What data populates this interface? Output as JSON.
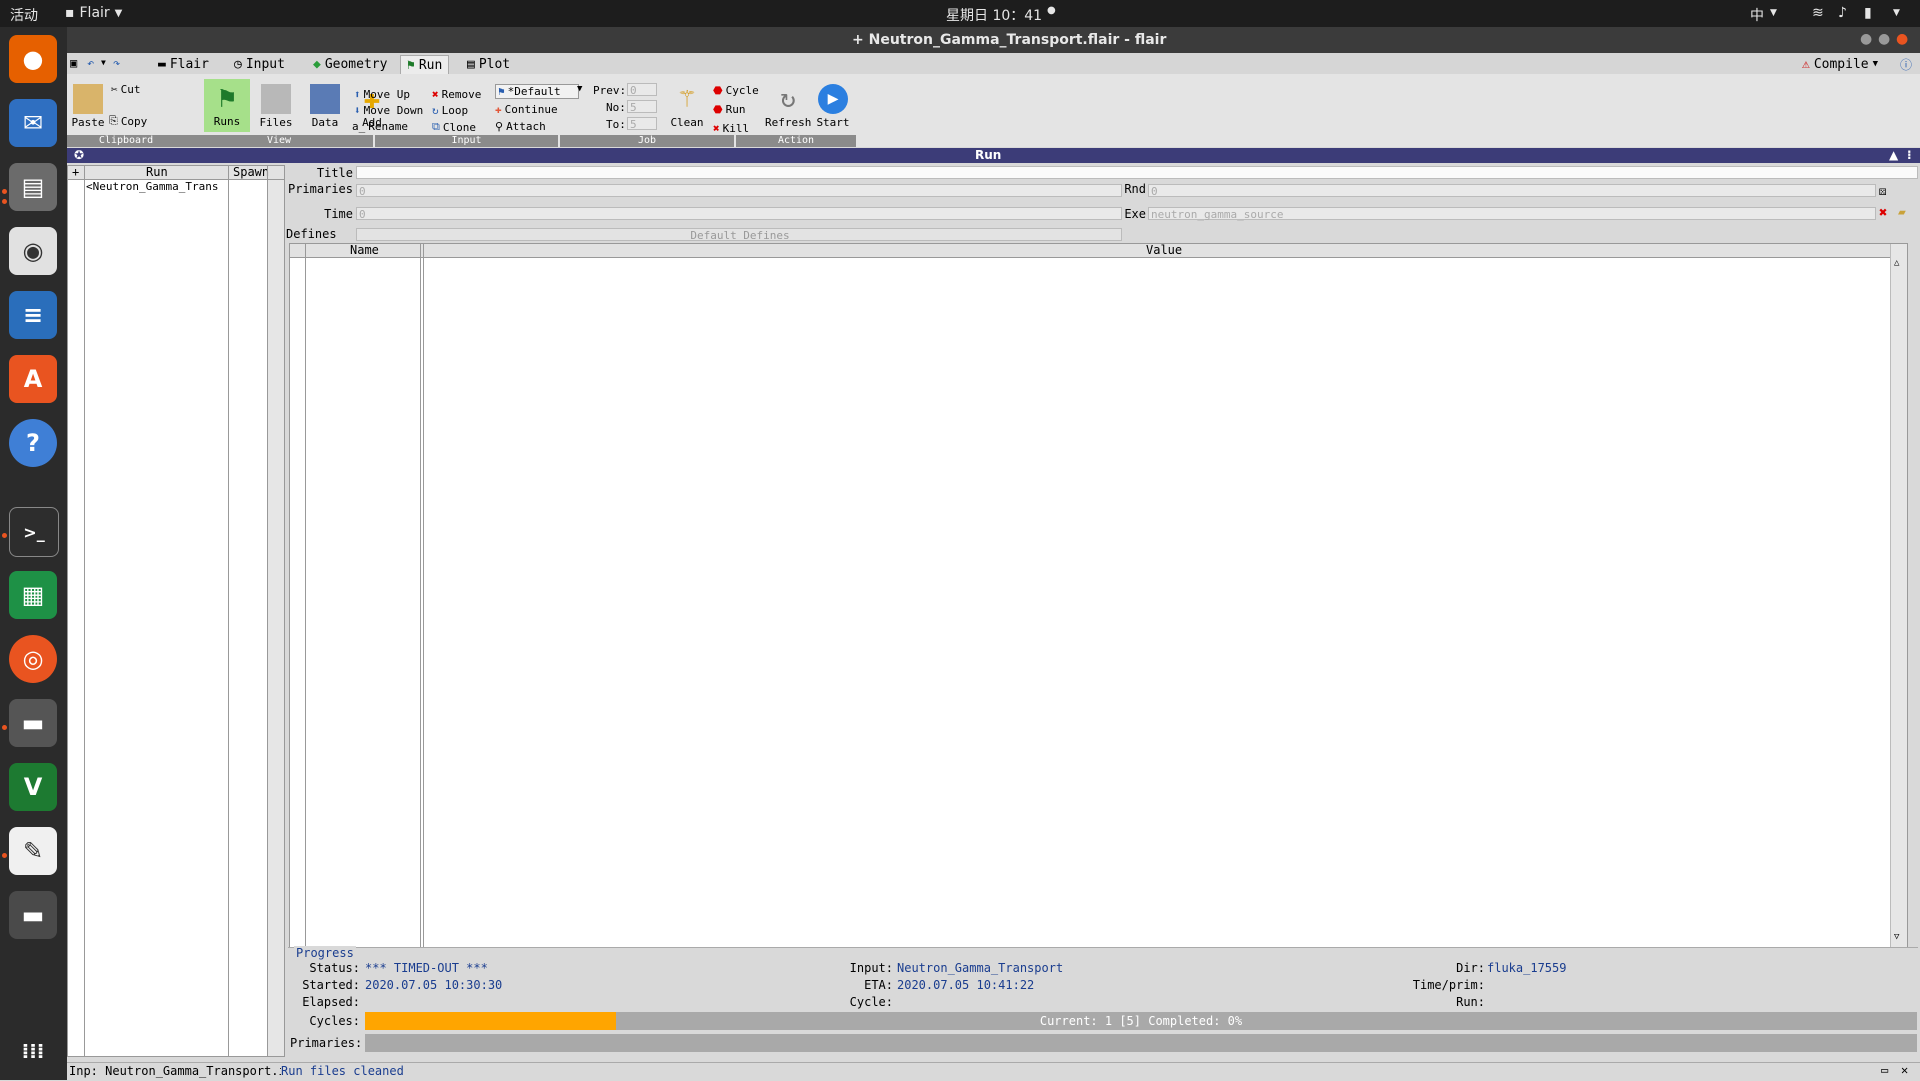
{
  "topbar": {
    "activities": "活动",
    "app_menu": "Flair",
    "clock": "星期日 10：41",
    "input_method": "中"
  },
  "window": {
    "title": "+ Neutron_Gamma_Transport.flair - flair"
  },
  "tabs": [
    {
      "label": "Flair"
    },
    {
      "label": "Input"
    },
    {
      "label": "Geometry"
    },
    {
      "label": "Run"
    },
    {
      "label": "Plot"
    }
  ],
  "compile_label": "Compile",
  "ribbon": {
    "clipboard": {
      "paste": "Paste",
      "cut": "Cut",
      "copy": "Copy",
      "group": "Clipboard"
    },
    "view": {
      "runs": "Runs",
      "files": "Files",
      "data": "Data",
      "group": "View"
    },
    "input": {
      "add": "Add",
      "move_up": "Move Up",
      "move_down": "Move Down",
      "rename": "Rename",
      "remove": "Remove",
      "loop": "Loop",
      "clone": "Clone",
      "group": "Input"
    },
    "job": {
      "default": "*Default",
      "continue": "Continue",
      "attach": "Attach",
      "prev_label": "Prev:",
      "no_label": "No:",
      "to_label": "To:",
      "prev": "0",
      "no": "5",
      "to": "5",
      "group": "Job"
    },
    "action": {
      "clean": "Clean",
      "cycle": "Cycle",
      "run": "Run",
      "kill": "Kill",
      "refresh": "Refresh",
      "start": "Start",
      "group": "Action"
    }
  },
  "run_header": "Run",
  "left_list": {
    "col_run": "Run",
    "col_spawn": "Spawn",
    "items": [
      "<Neutron_Gamma_Trans"
    ]
  },
  "form": {
    "title_label": "Title",
    "primaries_label": "Primaries",
    "primaries_value": "0",
    "rnd_label": "Rnd",
    "rnd_value": "0",
    "time_label": "Time",
    "time_value": "0",
    "exe_label": "Exe",
    "exe_value": "neutron_gamma_source",
    "defines_label": "Defines",
    "defines_button": "Default Defines"
  },
  "table": {
    "col_name": "Name",
    "col_value": "Value"
  },
  "progress": {
    "legend": "Progress",
    "status_label": "Status:",
    "status_value": "*** TIMED-OUT ***",
    "started_label": "Started:",
    "started_value": "2020.07.05 10:30:30",
    "elapsed_label": "Elapsed:",
    "cycles_label": "Cycles:",
    "primaries_label": "Primaries:",
    "input_label": "Input:",
    "input_value": "Neutron_Gamma_Transport",
    "eta_label": "ETA:",
    "eta_value": "2020.07.05 10:41:22",
    "cycle_label": "Cycle:",
    "dir_label": "Dir:",
    "dir_value": "fluka_17559",
    "timeprim_label": "Time/prim:",
    "run_label": "Run:",
    "cycles_text": "Current: 1 [5]  Completed: 0%",
    "cycles_fraction": 0.2
  },
  "statusbar": {
    "inp": "Inp: Neutron_Gamma_Transport.i",
    "message": "Run files cleaned"
  },
  "colors": {
    "run_header": "#3c3c78",
    "progress_fill": "#ffa500",
    "link_text": "#1a3d8f"
  }
}
